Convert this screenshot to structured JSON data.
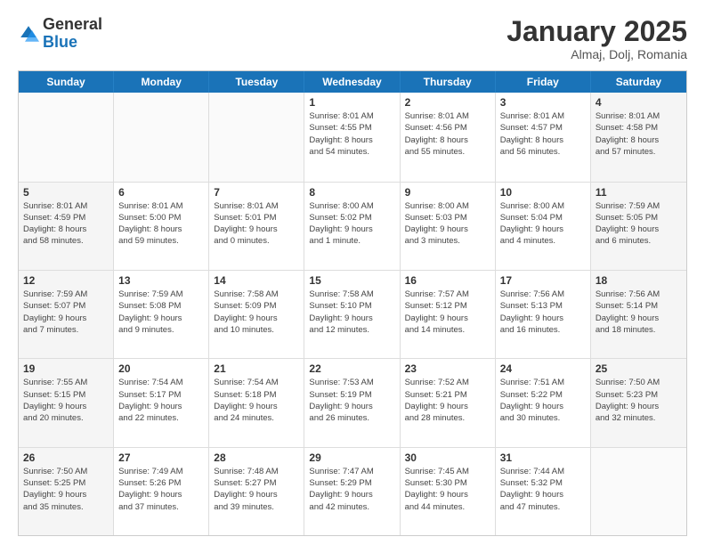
{
  "header": {
    "logo_general": "General",
    "logo_blue": "Blue",
    "month_title": "January 2025",
    "subtitle": "Almaj, Dolj, Romania"
  },
  "weekdays": [
    "Sunday",
    "Monday",
    "Tuesday",
    "Wednesday",
    "Thursday",
    "Friday",
    "Saturday"
  ],
  "weeks": [
    [
      {
        "day": "",
        "info": "",
        "empty": true
      },
      {
        "day": "",
        "info": "",
        "empty": true
      },
      {
        "day": "",
        "info": "",
        "empty": true
      },
      {
        "day": "1",
        "info": "Sunrise: 8:01 AM\nSunset: 4:55 PM\nDaylight: 8 hours\nand 54 minutes."
      },
      {
        "day": "2",
        "info": "Sunrise: 8:01 AM\nSunset: 4:56 PM\nDaylight: 8 hours\nand 55 minutes."
      },
      {
        "day": "3",
        "info": "Sunrise: 8:01 AM\nSunset: 4:57 PM\nDaylight: 8 hours\nand 56 minutes."
      },
      {
        "day": "4",
        "info": "Sunrise: 8:01 AM\nSunset: 4:58 PM\nDaylight: 8 hours\nand 57 minutes."
      }
    ],
    [
      {
        "day": "5",
        "info": "Sunrise: 8:01 AM\nSunset: 4:59 PM\nDaylight: 8 hours\nand 58 minutes."
      },
      {
        "day": "6",
        "info": "Sunrise: 8:01 AM\nSunset: 5:00 PM\nDaylight: 8 hours\nand 59 minutes."
      },
      {
        "day": "7",
        "info": "Sunrise: 8:01 AM\nSunset: 5:01 PM\nDaylight: 9 hours\nand 0 minutes."
      },
      {
        "day": "8",
        "info": "Sunrise: 8:00 AM\nSunset: 5:02 PM\nDaylight: 9 hours\nand 1 minute."
      },
      {
        "day": "9",
        "info": "Sunrise: 8:00 AM\nSunset: 5:03 PM\nDaylight: 9 hours\nand 3 minutes."
      },
      {
        "day": "10",
        "info": "Sunrise: 8:00 AM\nSunset: 5:04 PM\nDaylight: 9 hours\nand 4 minutes."
      },
      {
        "day": "11",
        "info": "Sunrise: 7:59 AM\nSunset: 5:05 PM\nDaylight: 9 hours\nand 6 minutes."
      }
    ],
    [
      {
        "day": "12",
        "info": "Sunrise: 7:59 AM\nSunset: 5:07 PM\nDaylight: 9 hours\nand 7 minutes."
      },
      {
        "day": "13",
        "info": "Sunrise: 7:59 AM\nSunset: 5:08 PM\nDaylight: 9 hours\nand 9 minutes."
      },
      {
        "day": "14",
        "info": "Sunrise: 7:58 AM\nSunset: 5:09 PM\nDaylight: 9 hours\nand 10 minutes."
      },
      {
        "day": "15",
        "info": "Sunrise: 7:58 AM\nSunset: 5:10 PM\nDaylight: 9 hours\nand 12 minutes."
      },
      {
        "day": "16",
        "info": "Sunrise: 7:57 AM\nSunset: 5:12 PM\nDaylight: 9 hours\nand 14 minutes."
      },
      {
        "day": "17",
        "info": "Sunrise: 7:56 AM\nSunset: 5:13 PM\nDaylight: 9 hours\nand 16 minutes."
      },
      {
        "day": "18",
        "info": "Sunrise: 7:56 AM\nSunset: 5:14 PM\nDaylight: 9 hours\nand 18 minutes."
      }
    ],
    [
      {
        "day": "19",
        "info": "Sunrise: 7:55 AM\nSunset: 5:15 PM\nDaylight: 9 hours\nand 20 minutes."
      },
      {
        "day": "20",
        "info": "Sunrise: 7:54 AM\nSunset: 5:17 PM\nDaylight: 9 hours\nand 22 minutes."
      },
      {
        "day": "21",
        "info": "Sunrise: 7:54 AM\nSunset: 5:18 PM\nDaylight: 9 hours\nand 24 minutes."
      },
      {
        "day": "22",
        "info": "Sunrise: 7:53 AM\nSunset: 5:19 PM\nDaylight: 9 hours\nand 26 minutes."
      },
      {
        "day": "23",
        "info": "Sunrise: 7:52 AM\nSunset: 5:21 PM\nDaylight: 9 hours\nand 28 minutes."
      },
      {
        "day": "24",
        "info": "Sunrise: 7:51 AM\nSunset: 5:22 PM\nDaylight: 9 hours\nand 30 minutes."
      },
      {
        "day": "25",
        "info": "Sunrise: 7:50 AM\nSunset: 5:23 PM\nDaylight: 9 hours\nand 32 minutes."
      }
    ],
    [
      {
        "day": "26",
        "info": "Sunrise: 7:50 AM\nSunset: 5:25 PM\nDaylight: 9 hours\nand 35 minutes."
      },
      {
        "day": "27",
        "info": "Sunrise: 7:49 AM\nSunset: 5:26 PM\nDaylight: 9 hours\nand 37 minutes."
      },
      {
        "day": "28",
        "info": "Sunrise: 7:48 AM\nSunset: 5:27 PM\nDaylight: 9 hours\nand 39 minutes."
      },
      {
        "day": "29",
        "info": "Sunrise: 7:47 AM\nSunset: 5:29 PM\nDaylight: 9 hours\nand 42 minutes."
      },
      {
        "day": "30",
        "info": "Sunrise: 7:45 AM\nSunset: 5:30 PM\nDaylight: 9 hours\nand 44 minutes."
      },
      {
        "day": "31",
        "info": "Sunrise: 7:44 AM\nSunset: 5:32 PM\nDaylight: 9 hours\nand 47 minutes."
      },
      {
        "day": "",
        "info": "",
        "empty": true
      }
    ]
  ]
}
